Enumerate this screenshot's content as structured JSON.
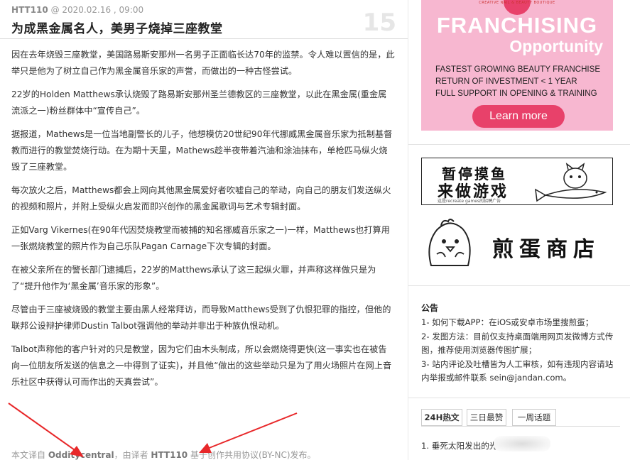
{
  "post": {
    "author": "HTT110",
    "date": "@ 2020.02.16 , 09:00",
    "number": "15",
    "title": "为成黑金属名人，美男子烧掉三座教堂",
    "paragraphs": [
      "因在去年烧毁三座教堂，美国路易斯安那州一名男子正面临长达70年的监禁。令人难以置信的是，此举只是他为了树立自己作为黑金属音乐家的声誉，而做出的一种古怪尝试。",
      "22岁的Holden Matthews承认烧毁了路易斯安那州圣兰德教区的三座教堂，以此在黑金属(重金属流派之一)粉丝群体中“宣传自己”。",
      "据报道，Mathews是一位当地副警长的儿子，他想模仿20世纪90年代挪威黑金属音乐家为抵制基督教而进行的教堂焚烧行动。在为期十天里，Mathews趁半夜带着汽油和涂油抹布，单枪匹马纵火烧毁了三座教堂。",
      "每次放火之后，Matthews都会上网向其他黑金属爱好者吹嘘自己的举动，向自己的朋友们发送纵火的视频和照片，并附上受纵火启发而即兴创作的黑金属歌词与艺术专辑封面。",
      "正如Varg Vikernes(在90年代因焚烧教堂而被捕的知名挪威音乐家之一)一样，Matthews也打算用一张燃烧教堂的照片作为自己乐队Pagan Carnage下次专辑的封面。",
      "在被父亲所在的警长部门逮捕后，22岁的Matthews承认了这三起纵火罪，并声称这样做只是为了“提升他作为‘黑金属’音乐家的形象”。",
      "尽管由于三座被烧毁的教堂主要由黑人经常拜访，而导致Matthews受到了仇恨犯罪的指控，但他的联邦公设辩护律师Dustin Talbot强调他的举动并非出于种族仇恨动机。",
      "Talbot声称他的客户针对的只是教堂，因为它们由木头制成，所以会燃烧得更快(这一事实也在被告向一位朋友所发送的信息之一中得到了证实)，并且他“做出的这些举动只是为了用火场照片在网上音乐社区中获得认可而作出的天真尝试”。"
    ],
    "footer": {
      "prefix": "本文译自",
      "source": "Odditycentral",
      "middle": "，由译者",
      "translator": "HTT110",
      "suffix": "基于创作共用协议(BY-NC)发布。"
    }
  },
  "sidebar": {
    "ad_franchise": {
      "logo_text": "CREATIVE NAIL & BEAUTY BOUTIQUE",
      "headline": "FRANCHISING",
      "subheadline": "Opportunity",
      "lines": [
        "FASTEST GROWING BEAUTY FRANCHISE",
        "RETURN OF INVESTMENT < 1 YEAR",
        "FULL SUPPORT IN OPENING & TRAINING"
      ],
      "button": "Learn more",
      "accent": "#e8416a",
      "background": "#f7b7d0"
    },
    "ad_game": {
      "line1": "暂停摸鱼",
      "line2": "来做游戏",
      "sub": "这是recreate games的招聘广告"
    },
    "ad_shop": {
      "text": "煎蛋商店",
      "mascot_icon": "chick-mascot-icon"
    },
    "notice": {
      "heading": "公告",
      "items": [
        "1- 如何下载APP：在iOS或安卓市场里搜煎蛋；",
        "2- 发图方法：目前仅支持桌面端用网页发微博方式传图，推荐使用浏览器传图扩展；",
        "3- 站内评论及吐槽皆为人工审核，如有违规内容请站内举报或邮件联系 sein@jandan.com。"
      ]
    },
    "tabs": [
      {
        "label": "24H热文",
        "active": true
      },
      {
        "label": "三日最赞",
        "active": false
      },
      {
        "label": "一周话题",
        "active": false
      }
    ],
    "hot_first": "1. 垂死太阳发出的光"
  },
  "annotation": {
    "arrow_color": "#e8282a"
  }
}
